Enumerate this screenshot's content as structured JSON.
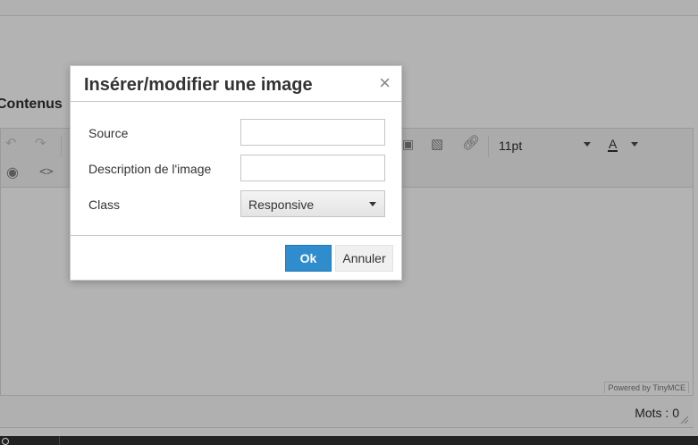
{
  "page": {
    "section_title": "Contenus"
  },
  "editor": {
    "toolbar": {
      "icons": [
        "undo-icon",
        "redo-icon",
        "preview-icon",
        "code-icon",
        "search-replace-icon",
        "image-icon",
        "link-icon"
      ],
      "font_size": "11pt",
      "forecolor_label": "A"
    },
    "powered_by": "Powered by TinyMCE",
    "word_count": "Mots : 0"
  },
  "dialog": {
    "title": "Insérer/modifier une image",
    "close_glyph": "×",
    "fields": {
      "source_label": "Source",
      "source_value": "",
      "description_label": "Description de l'image",
      "description_value": "",
      "class_label": "Class",
      "class_value": "Responsive"
    },
    "buttons": {
      "ok": "Ok",
      "cancel": "Annuler"
    }
  },
  "colors": {
    "overlay": "#b3b3b3",
    "primary_button": "#2f8ccd",
    "dialog_bg": "#ffffff"
  }
}
